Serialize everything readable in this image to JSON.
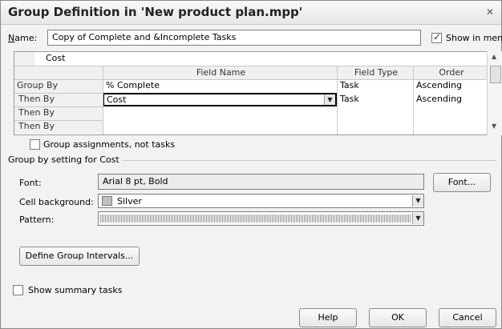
{
  "window": {
    "title": "Group Definition in 'New product plan.mpp'",
    "close_glyph": "✕"
  },
  "name_row": {
    "label": "Name:",
    "value": "Copy of Complete and &Incomplete Tasks",
    "show_in_menu_label": "Show in menu",
    "show_in_menu_checked": true
  },
  "grid": {
    "edit_value": "Cost",
    "headers": [
      "",
      "Field Name",
      "Field Type",
      "Order"
    ],
    "rows": [
      {
        "label": "Group By",
        "field": "% Complete",
        "type": "Task",
        "order": "Ascending"
      },
      {
        "label": "Then By",
        "field": "Cost",
        "type": "Task",
        "order": "Ascending"
      },
      {
        "label": "Then By",
        "field": "",
        "type": "",
        "order": ""
      },
      {
        "label": "Then By",
        "field": "",
        "type": "",
        "order": ""
      }
    ]
  },
  "group_assignments": {
    "label": "Group assignments, not tasks",
    "checked": false
  },
  "group_by_setting": {
    "heading": "Group by setting for Cost",
    "font_label": "Font:",
    "font_value": "Arial 8 pt, Bold",
    "font_button": "Font...",
    "cell_background_label": "Cell background:",
    "cell_background_value": "Silver",
    "pattern_label": "Pattern:"
  },
  "define_intervals_button": "Define Group Intervals...",
  "show_summary": {
    "label": "Show summary tasks",
    "checked": false
  },
  "buttons": {
    "help": "Help",
    "ok": "OK",
    "cancel": "Cancel"
  },
  "colors": {
    "swatch_silver": "#c0c0c0"
  }
}
